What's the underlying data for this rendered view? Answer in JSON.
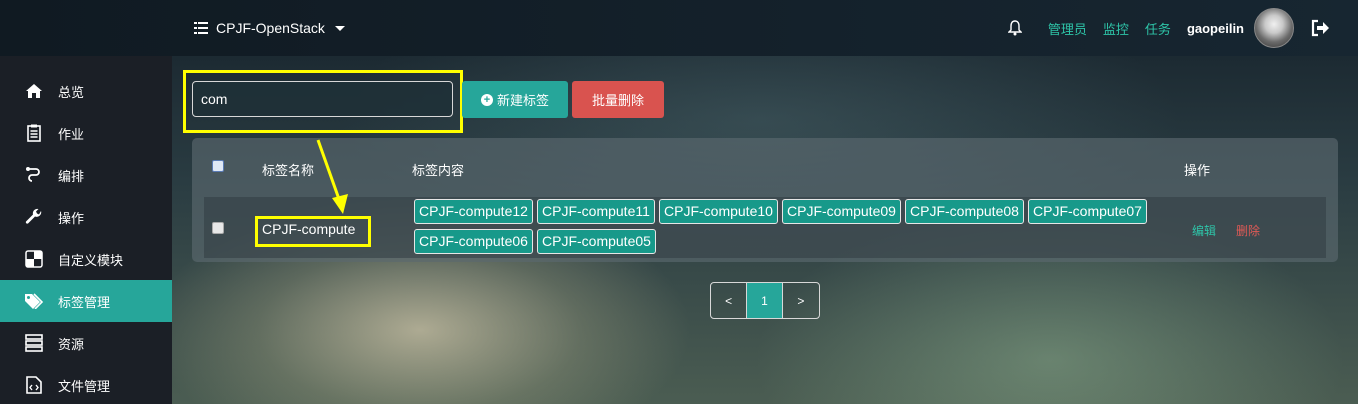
{
  "header": {
    "brand": "CPJF-OpenStack",
    "links": [
      "管理员",
      "监控",
      "任务"
    ],
    "user": "gaopeilin"
  },
  "sidebar": {
    "items": [
      {
        "label": "总览",
        "icon": "home-icon"
      },
      {
        "label": "作业",
        "icon": "clipboard-icon"
      },
      {
        "label": "编排",
        "icon": "link-icon"
      },
      {
        "label": "操作",
        "icon": "wrench-icon"
      },
      {
        "label": "自定义模块",
        "icon": "puzzle-icon"
      },
      {
        "label": "标签管理",
        "icon": "tags-icon",
        "active": true
      },
      {
        "label": "资源",
        "icon": "server-icon"
      },
      {
        "label": "文件管理",
        "icon": "file-code-icon"
      }
    ]
  },
  "toolbar": {
    "search_value": "com",
    "new_label": "新建标签",
    "batch_delete_label": "批量删除"
  },
  "table": {
    "headers": {
      "name": "标签名称",
      "content": "标签内容",
      "ops": "操作"
    },
    "rows": [
      {
        "name": "CPJF-compute",
        "tags": [
          "CPJF-compute12",
          "CPJF-compute11",
          "CPJF-compute10",
          "CPJF-compute09",
          "CPJF-compute08",
          "CPJF-compute07",
          "CPJF-compute06",
          "CPJF-compute05"
        ],
        "edit": "编辑",
        "delete": "删除"
      }
    ]
  },
  "pagination": {
    "prev": "<",
    "current": "1",
    "next": ">"
  },
  "colors": {
    "accent": "#26a69a",
    "danger": "#d9534f",
    "highlight": "#ffff00"
  }
}
